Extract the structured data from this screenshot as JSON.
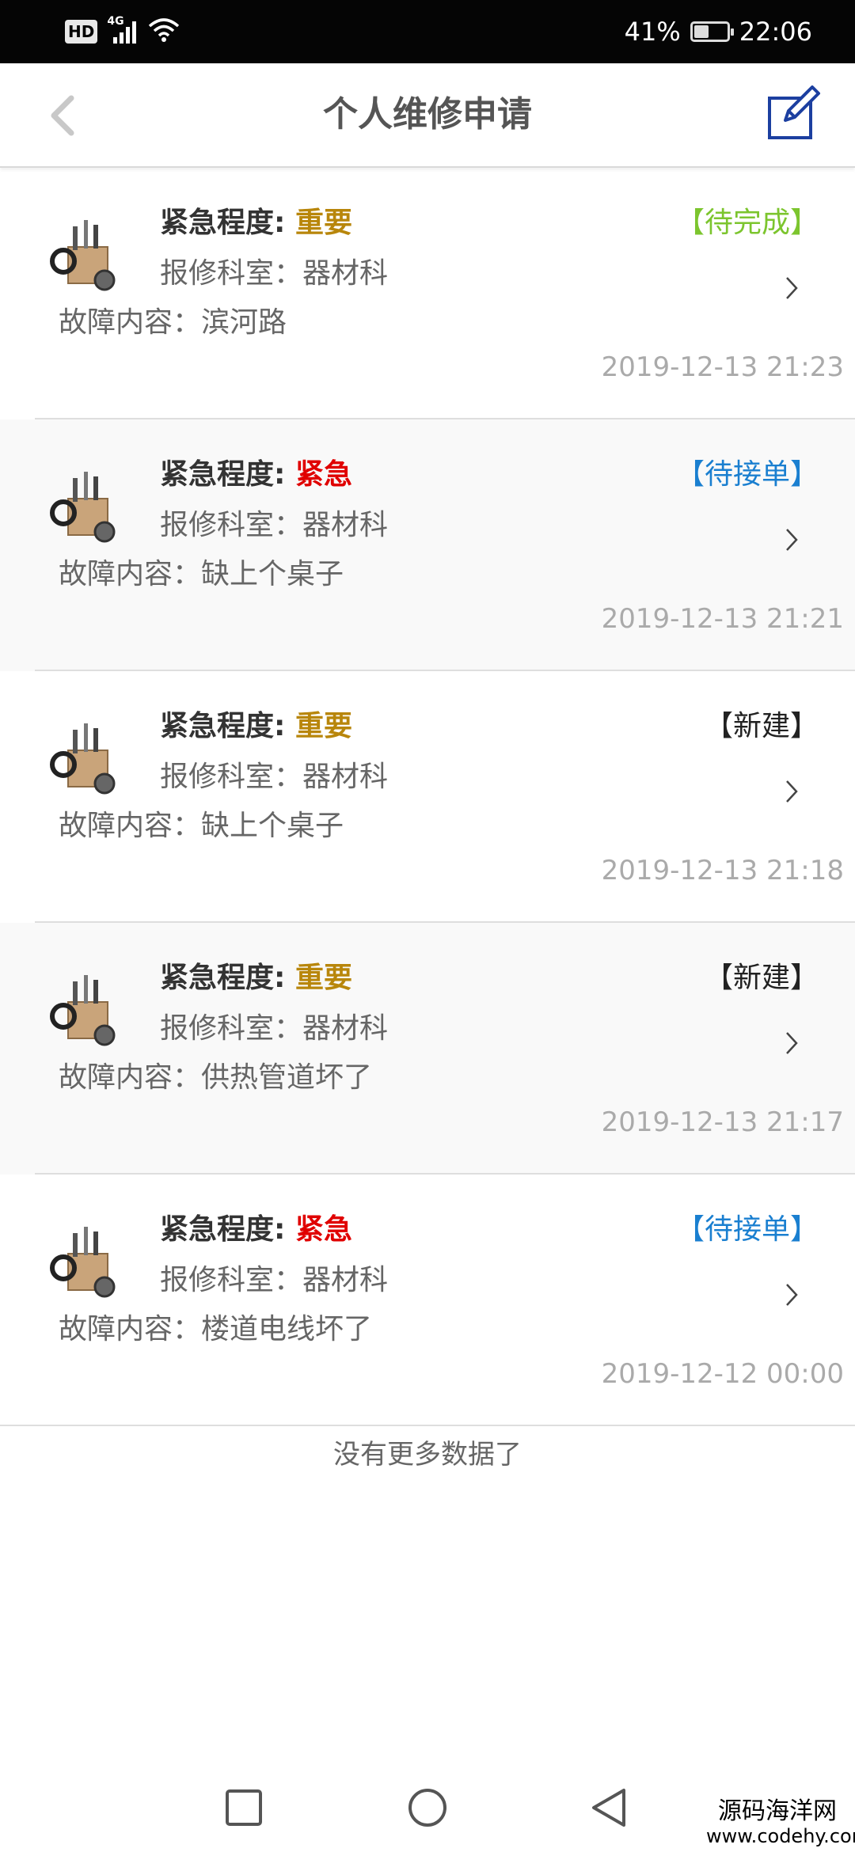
{
  "status_bar": {
    "hd": "HD",
    "network": "4G",
    "battery_percent": "41%",
    "battery_level": 0.41,
    "time": "22:06"
  },
  "header": {
    "title": "个人维修申请",
    "back_icon": "chevron-left-icon",
    "edit_icon": "edit-icon"
  },
  "labels": {
    "urgency": "紧急程度: ",
    "department": "报修科室：",
    "fault": "故障内容："
  },
  "colors": {
    "important": "#b8860b",
    "urgent": "#e00000",
    "pending_complete": "#7cc52e",
    "pending_accept": "#1a7fd0",
    "new": "#222222"
  },
  "items": [
    {
      "level": "重要",
      "level_color": "#b8860b",
      "status": "【待完成】",
      "status_color": "#7cc52e",
      "department": "器材科",
      "fault": "滨河路",
      "time": "2019-12-13 21:23"
    },
    {
      "level": "紧急",
      "level_color": "#e00000",
      "status": "【待接单】",
      "status_color": "#1a7fd0",
      "department": "器材科",
      "fault": "缺上个桌子",
      "time": "2019-12-13 21:21"
    },
    {
      "level": "重要",
      "level_color": "#b8860b",
      "status": "【新建】",
      "status_color": "#222222",
      "department": "器材科",
      "fault": "缺上个桌子",
      "time": "2019-12-13 21:18"
    },
    {
      "level": "重要",
      "level_color": "#b8860b",
      "status": "【新建】",
      "status_color": "#222222",
      "department": "器材科",
      "fault": "供热管道坏了",
      "time": "2019-12-13 21:17"
    },
    {
      "level": "紧急",
      "level_color": "#e00000",
      "status": "【待接单】",
      "status_color": "#1a7fd0",
      "department": "器材科",
      "fault": "楼道电线坏了",
      "time": "2019-12-12 00:00"
    }
  ],
  "footer_text": "没有更多数据了",
  "navbar": {
    "recent_icon": "square-icon",
    "home_icon": "circle-icon",
    "back_icon": "triangle-back-icon"
  },
  "watermark": {
    "line1": "源码海洋网",
    "line2": "www.codehy.com"
  }
}
